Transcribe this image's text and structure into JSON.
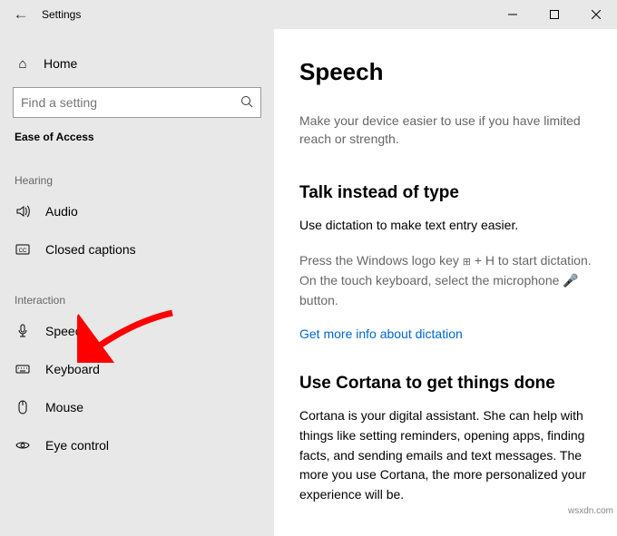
{
  "titlebar": {
    "title": "Settings"
  },
  "sidebar": {
    "home": "Home",
    "search_placeholder": "Find a setting",
    "category": "Ease of Access",
    "groups": [
      {
        "label": "Hearing",
        "items": [
          "Audio",
          "Closed captions"
        ]
      },
      {
        "label": "Interaction",
        "items": [
          "Speech",
          "Keyboard",
          "Mouse",
          "Eye control"
        ]
      }
    ]
  },
  "main": {
    "title": "Speech",
    "lede": "Make your device easier to use if you have limited reach or strength.",
    "talk": {
      "heading": "Talk instead of type",
      "p1": "Use dictation to make text entry easier.",
      "p2a": "Press the Windows logo key ",
      "p2b": " + H to start dictation. On the touch keyboard, select the microphone ",
      "p2c": " button.",
      "link": "Get more info about dictation"
    },
    "cortana": {
      "heading": "Use Cortana to get things done",
      "p1": "Cortana is your digital assistant.  She can help with things like setting reminders, opening apps, finding facts, and sending emails and text messages.  The more you use Cortana, the more personalized your experience will be."
    }
  },
  "watermark": "wsxdn.com"
}
